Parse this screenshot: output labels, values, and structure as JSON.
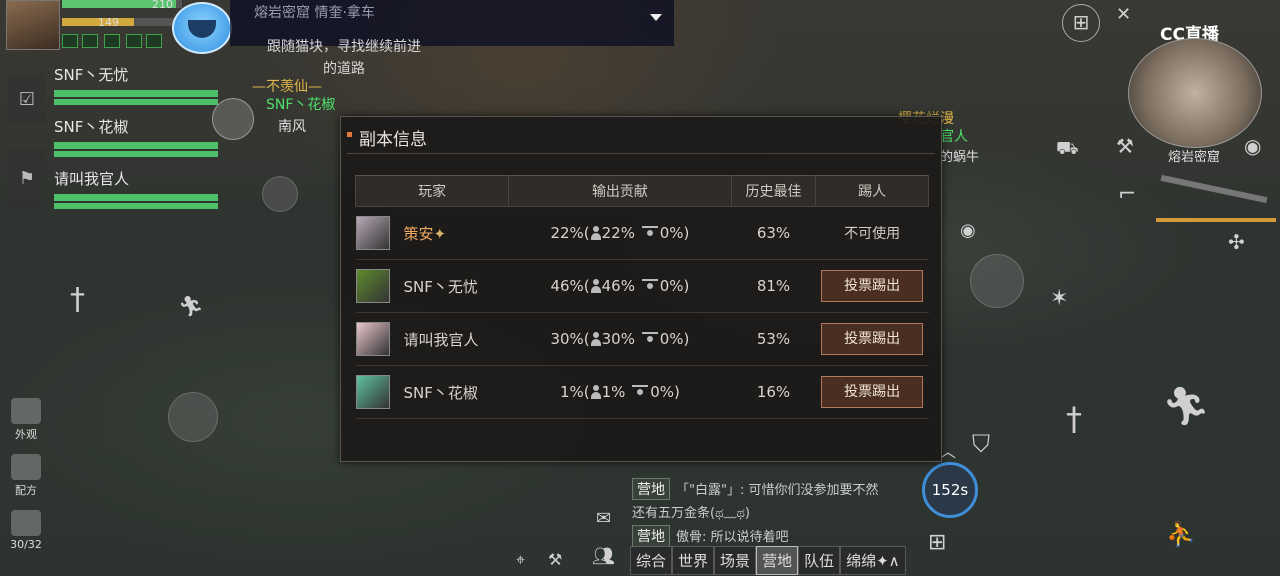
{
  "player": {
    "hp_value": "210",
    "level": "149",
    "hp_fraction": 0.95,
    "energy_fraction": 0.6
  },
  "quest": {
    "title": "熔岩密窟  情奎·拿车",
    "line1": "跟随猫块，寻找继续前进",
    "line2": "的道路"
  },
  "team": [
    {
      "name": "SNF丶无忧",
      "hp_fraction": 1.0,
      "mp_fraction": 1.0
    },
    {
      "name": "SNF丶花椒",
      "hp_fraction": 1.0,
      "mp_fraction": 1.0
    },
    {
      "name": "请叫我官人",
      "hp_fraction": 1.0,
      "mp_fraction": 1.0
    }
  ],
  "world_labels": {
    "title1": "—不羡仙—",
    "name1": "SNF丶花椒",
    "name2": "南风",
    "title2": "樱花烂漫",
    "name3": "官人",
    "name4": "的蜗牛"
  },
  "minimap": {
    "location": "熔岩密窟"
  },
  "streamer_logo": "CC直播",
  "skill_timer": "152s",
  "inventory": "30/32",
  "left_menu": {
    "appearance": "外观",
    "recipe": "配方"
  },
  "panel": {
    "title": "副本信息",
    "headers": {
      "player": "玩家",
      "damage": "输出贡献",
      "best": "历史最佳",
      "kick": "踢人"
    },
    "rows": [
      {
        "name": "策安",
        "star": "✦",
        "total": "22%(",
        "solo": "22%",
        "other": "0%)",
        "best": "63%",
        "kick": "不可使用",
        "kickable": false,
        "avatar_color": "#b7a9b6",
        "highlight": true
      },
      {
        "name": "SNF丶无忧",
        "star": "",
        "total": "46%(",
        "solo": "46%",
        "other": "0%)",
        "best": "81%",
        "kick": "投票踢出",
        "kickable": true,
        "avatar_color": "#5e8a2e",
        "highlight": false
      },
      {
        "name": "请叫我官人",
        "star": "",
        "total": "30%(",
        "solo": "30%",
        "other": "0%)",
        "best": "53%",
        "kick": "投票踢出",
        "kickable": true,
        "avatar_color": "#e8c6cc",
        "highlight": false
      },
      {
        "name": "SNF丶花椒",
        "star": "",
        "total": "1%(",
        "solo": "1%",
        "other": "0%)",
        "best": "16%",
        "kick": "投票踢出",
        "kickable": true,
        "avatar_color": "#5fc0a0",
        "highlight": false
      }
    ]
  },
  "chat": {
    "messages": [
      {
        "channel": "营地",
        "text": "「\"白露\"」: 可惜你们没参加要不然"
      },
      {
        "channel": "",
        "text": "还有五万金条(ಥ﹏ಥ)"
      },
      {
        "channel": "营地",
        "text": "傲骨: 所以说待着吧"
      }
    ],
    "tabs": [
      "综合",
      "世界",
      "场景",
      "营地",
      "队伍",
      "绵绵✦∧"
    ],
    "active_tab": 3
  },
  "colors": {
    "accent": "#e07a3a",
    "kick_bg": "#4a2e24",
    "hp_green": "#4ec06a"
  }
}
